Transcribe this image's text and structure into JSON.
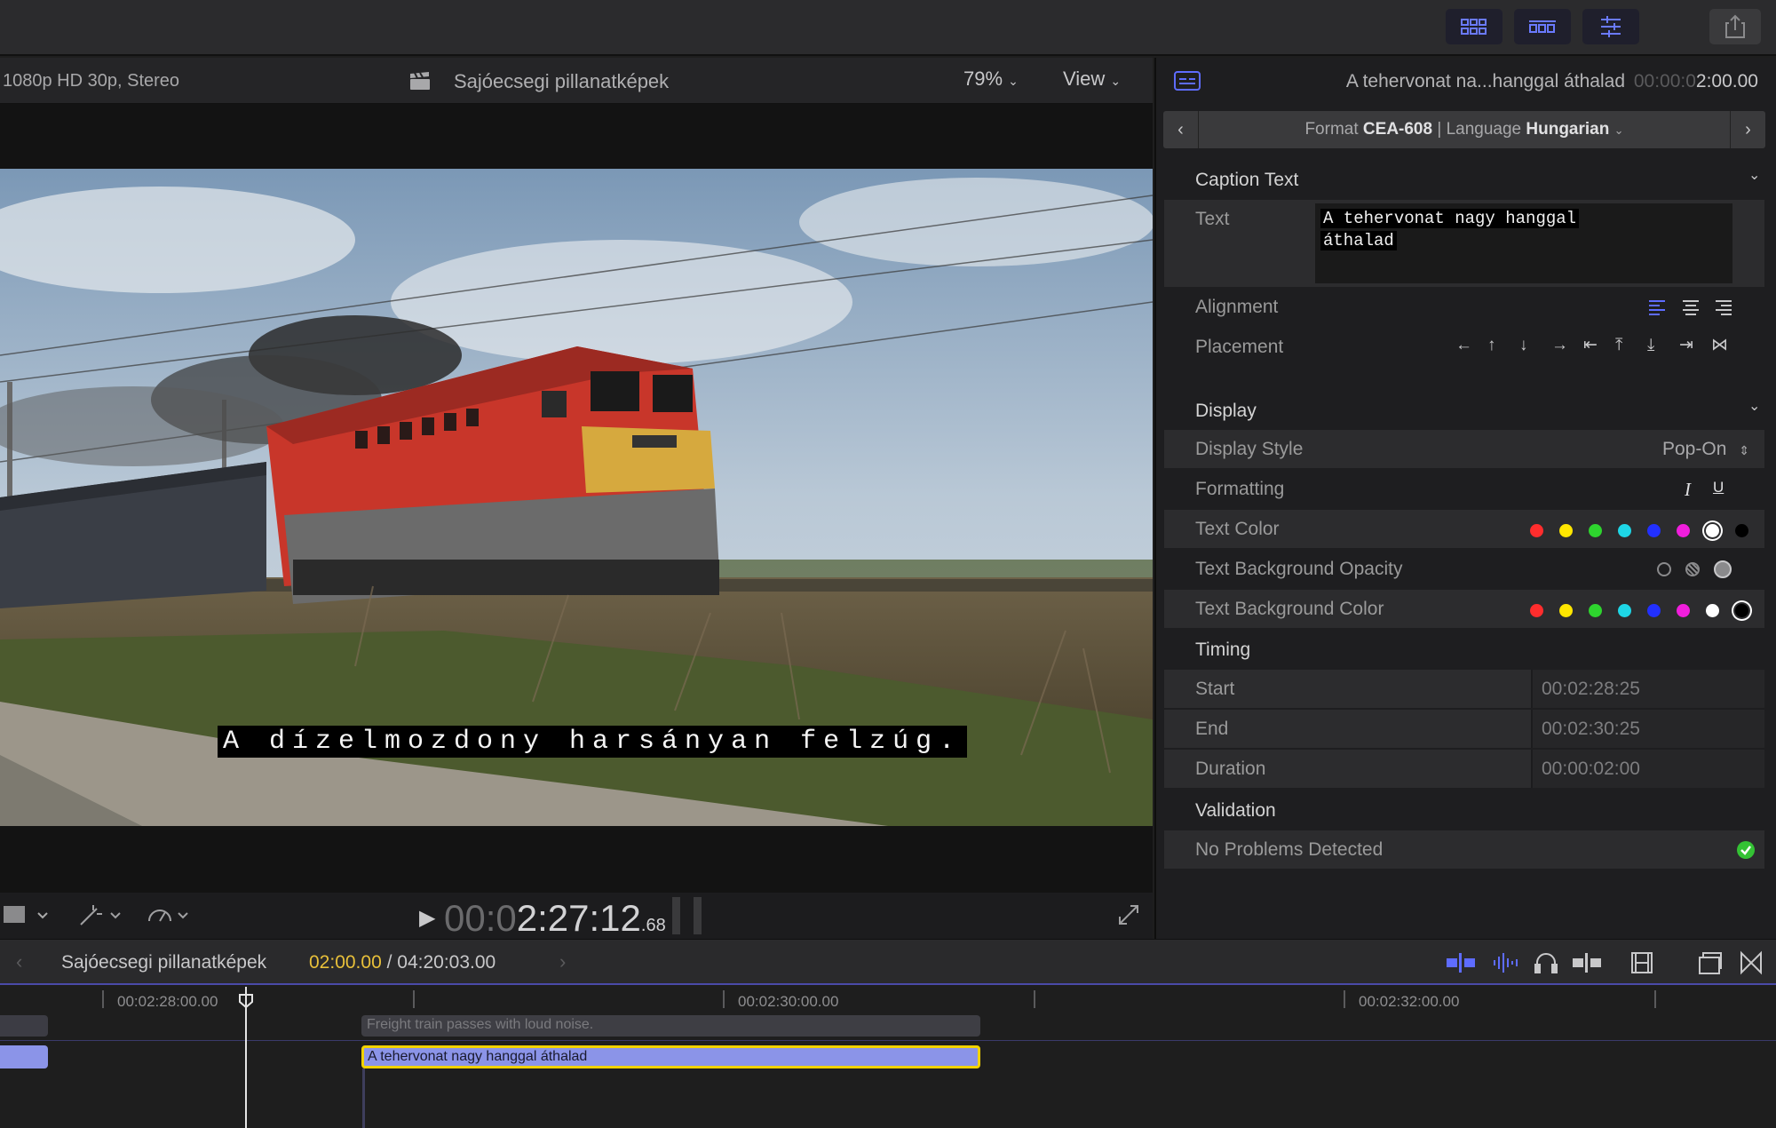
{
  "toolbar": {
    "buttons": [
      "browser-icon",
      "timeline-icon",
      "inspector-icon",
      "share-icon"
    ]
  },
  "viewer": {
    "format": "1080p HD 30p, Stereo",
    "project_name": "Sajóecsegi pillanatképek",
    "zoom": "79%",
    "view_label": "View",
    "caption_overlay": "A dízelmozdony harsányan felzúg.",
    "timecode_dim": "00:0",
    "timecode_main": "2:27:12",
    "timecode_frames": ".68"
  },
  "inspector": {
    "header_title": "A tehervonat na...hanggal  áthalad",
    "header_time_dim": "00:00:0",
    "header_time": "2:00.00",
    "format_prefix": "Format",
    "format_value": "CEA-608",
    "language_prefix": "| Language",
    "language_value": "Hungarian",
    "caption_text_section": "Caption Text",
    "text_label": "Text",
    "text_value_line1": "A tehervonat nagy hanggal ",
    "text_value_line2": "áthalad",
    "alignment_label": "Alignment",
    "placement_label": "Placement",
    "display_section": "Display",
    "display_style_label": "Display Style",
    "display_style_value": "Pop-On",
    "formatting_label": "Formatting",
    "italic_glyph": "I",
    "underline_glyph": "U",
    "text_color_label": "Text Color",
    "text_bg_opacity_label": "Text Background Opacity",
    "text_bg_color_label": "Text Background Color",
    "timing_section": "Timing",
    "start_label": "Start",
    "start_value": "00:02:28:25",
    "end_label": "End",
    "end_value": "00:02:30:25",
    "duration_label": "Duration",
    "duration_value": "00:00:02:00",
    "validation_section": "Validation",
    "validation_status": "No Problems Detected",
    "colors": {
      "red": "#ff2d2d",
      "yellow": "#ffe600",
      "green": "#2ed42e",
      "cyan": "#1ed6e6",
      "blue": "#2230ff",
      "magenta": "#f01edc",
      "white": "#ffffff",
      "black": "#000000"
    }
  },
  "timeline": {
    "project_name": "Sajóecsegi pillanatképek",
    "position": "02:00.00",
    "separator": " / ",
    "duration": "04:20:03.00",
    "ruler": [
      "00:02:28:00.00",
      "00:02:30:00.00",
      "00:02:32:00.00"
    ],
    "role_clip_label": "Freight train passes with loud noise.",
    "caption_clip_label": "A tehervonat nagy hanggal  áthalad"
  }
}
